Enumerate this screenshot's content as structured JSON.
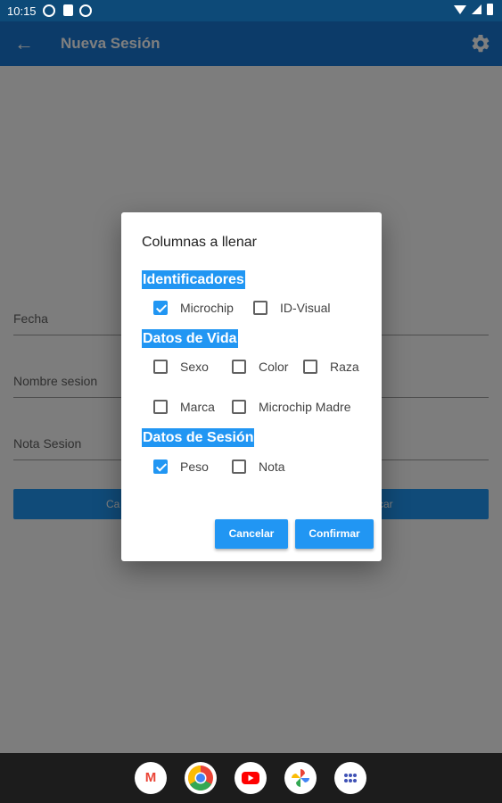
{
  "status_bar": {
    "time": "10:15"
  },
  "app_bar": {
    "title": "Nueva Sesión"
  },
  "form": {
    "fields": [
      {
        "label": "Fecha"
      },
      {
        "label": "Nombre sesion"
      },
      {
        "label": "Nota Sesion"
      }
    ],
    "buttons": {
      "left_partial": "Ca",
      "right_partial": "car"
    }
  },
  "dialog": {
    "title": "Columnas a llenar",
    "sections": [
      {
        "header": "Identificadores",
        "options": [
          {
            "label": "Microchip",
            "checked": true
          },
          {
            "label": "ID-Visual",
            "checked": false
          }
        ]
      },
      {
        "header": "Datos de Vida",
        "options": [
          {
            "label": "Sexo",
            "checked": false
          },
          {
            "label": "Color",
            "checked": false
          },
          {
            "label": "Raza",
            "checked": false
          },
          {
            "label": "Marca",
            "checked": false
          },
          {
            "label": "Microchip Madre",
            "checked": false
          }
        ]
      },
      {
        "header": "Datos de Sesión",
        "options": [
          {
            "label": "Peso",
            "checked": true
          },
          {
            "label": "Nota",
            "checked": false
          }
        ]
      }
    ],
    "cancel_label": "Cancelar",
    "confirm_label": "Confirmar"
  },
  "dock": {
    "apps": [
      {
        "icon": "gmail-icon",
        "glyph": "M"
      },
      {
        "icon": "chrome-icon",
        "glyph": ""
      },
      {
        "icon": "youtube-icon",
        "glyph": ""
      },
      {
        "icon": "photos-icon",
        "glyph": ""
      },
      {
        "icon": "app-drawer-icon",
        "glyph": ""
      }
    ]
  },
  "colors": {
    "primary": "#2196f3",
    "app_bar": "#1976d2",
    "status_bar": "#0d4a78"
  }
}
